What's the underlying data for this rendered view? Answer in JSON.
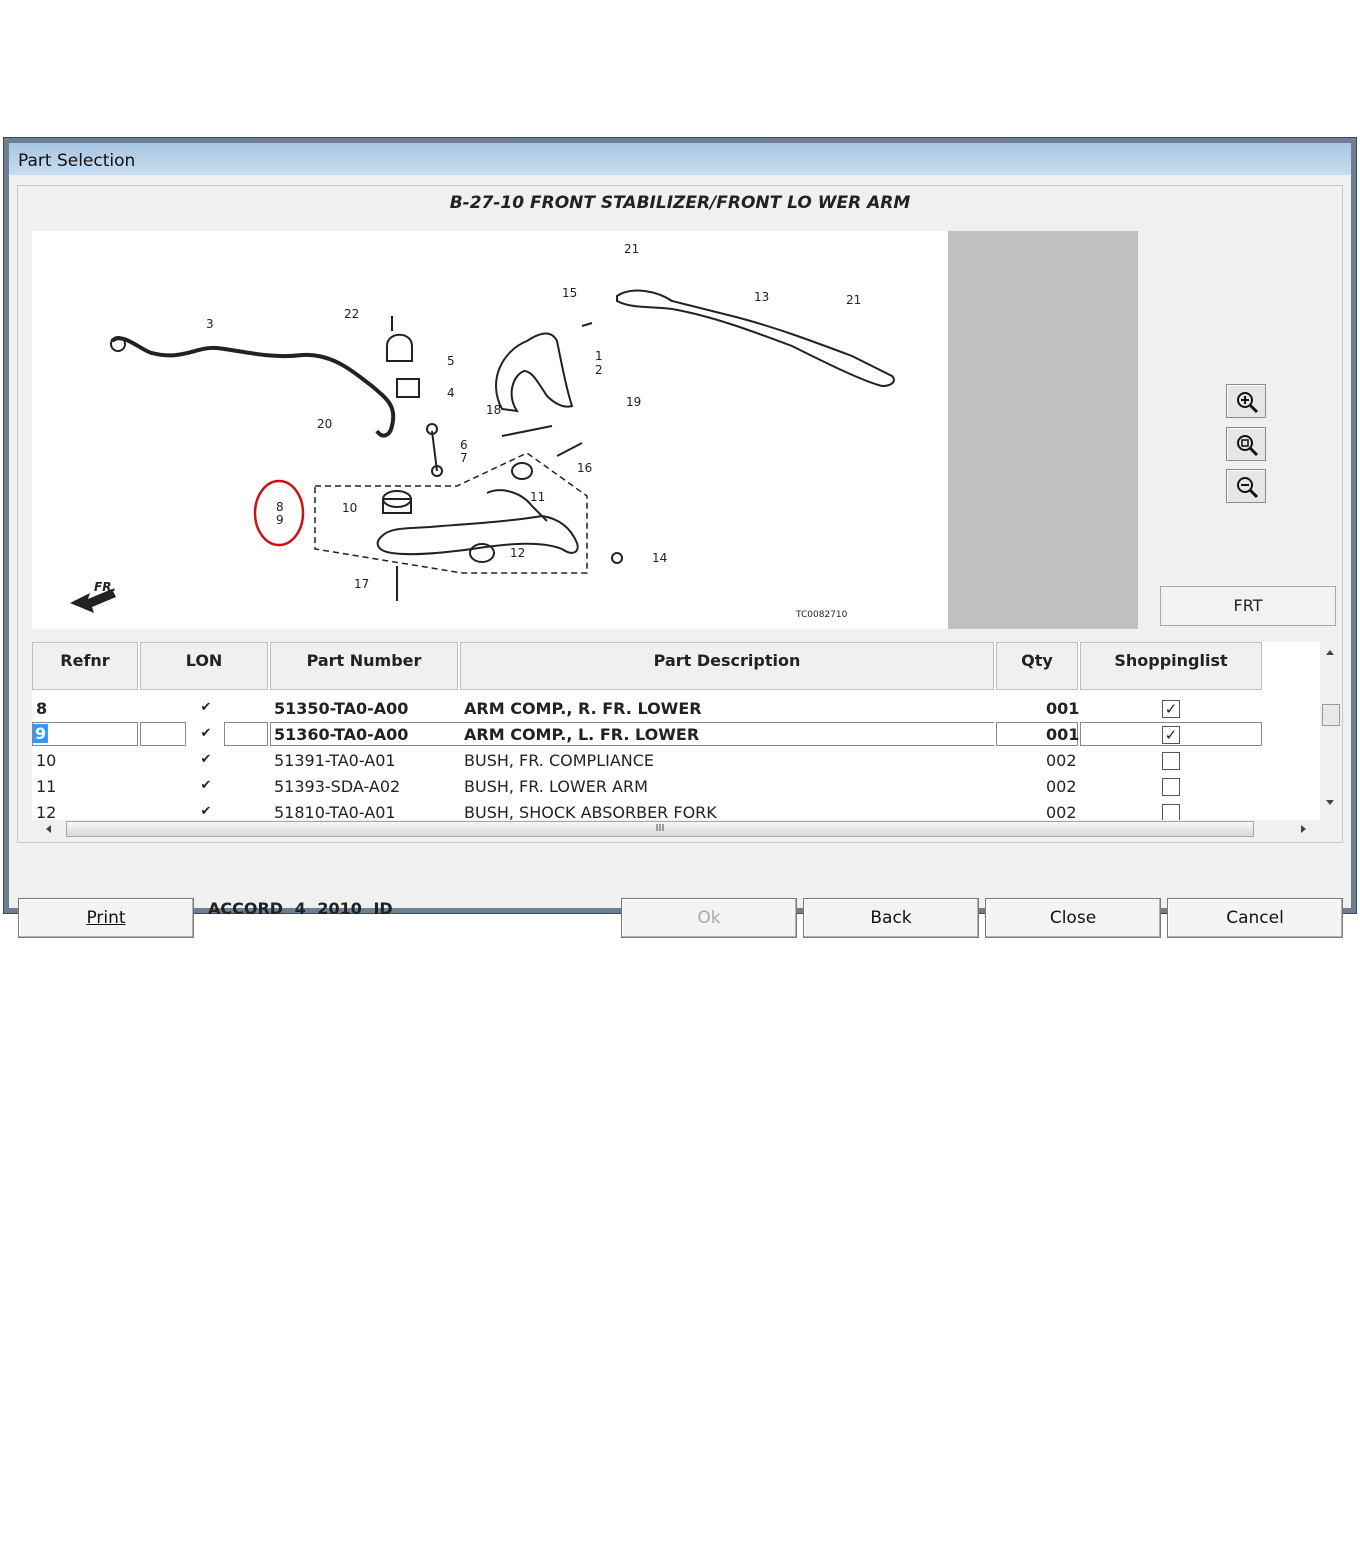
{
  "window": {
    "title": "Part Selection"
  },
  "diagram": {
    "title": "B-27-10 FRONT STABILIZER/FRONT LO WER ARM",
    "code": "TC0082710",
    "callouts": [
      "21",
      "15",
      "13",
      "21",
      "3",
      "22",
      "5",
      "4",
      "1",
      "2",
      "19",
      "18",
      "20",
      "6",
      "7",
      "16",
      "11",
      "10",
      "12",
      "14",
      "17",
      "8",
      "9"
    ],
    "direction_label": "FR."
  },
  "zoom_buttons": [
    {
      "icon": "zoom-in-icon"
    },
    {
      "icon": "zoom-fit-icon"
    },
    {
      "icon": "zoom-out-icon"
    }
  ],
  "frt_button": "FRT",
  "grid": {
    "columns": [
      "Refnr",
      "LON",
      "Part Number",
      "Part Description",
      "Qty",
      "Shoppinglist"
    ],
    "rows": [
      {
        "refnr": "8",
        "lon": "✔",
        "part_number": "51350-TA0-A00",
        "description": "ARM COMP., R. FR. LOWER",
        "qty": "001",
        "shopping": true
      },
      {
        "refnr": "9",
        "lon": "✔",
        "part_number": "51360-TA0-A00",
        "description": "ARM COMP., L. FR. LOWER",
        "qty": "001",
        "shopping": true
      },
      {
        "refnr": "10",
        "lon": "✔",
        "part_number": "51391-TA0-A01",
        "description": "BUSH, FR. COMPLIANCE",
        "qty": "002",
        "shopping": false
      },
      {
        "refnr": "11",
        "lon": "✔",
        "part_number": "51393-SDA-A02",
        "description": "BUSH, FR. LOWER ARM",
        "qty": "002",
        "shopping": false
      },
      {
        "refnr": "12",
        "lon": "✔",
        "part_number": "51810-TA0-A01",
        "description": "BUSH, SHOCK ABSORBER FORK",
        "qty": "002",
        "shopping": false
      }
    ],
    "hscroll_grip": "III"
  },
  "footer": {
    "print": "Print",
    "vehicle": "ACCORD 4 2010 ID",
    "ok": "Ok",
    "back": "Back",
    "close": "Close",
    "cancel": "Cancel"
  }
}
